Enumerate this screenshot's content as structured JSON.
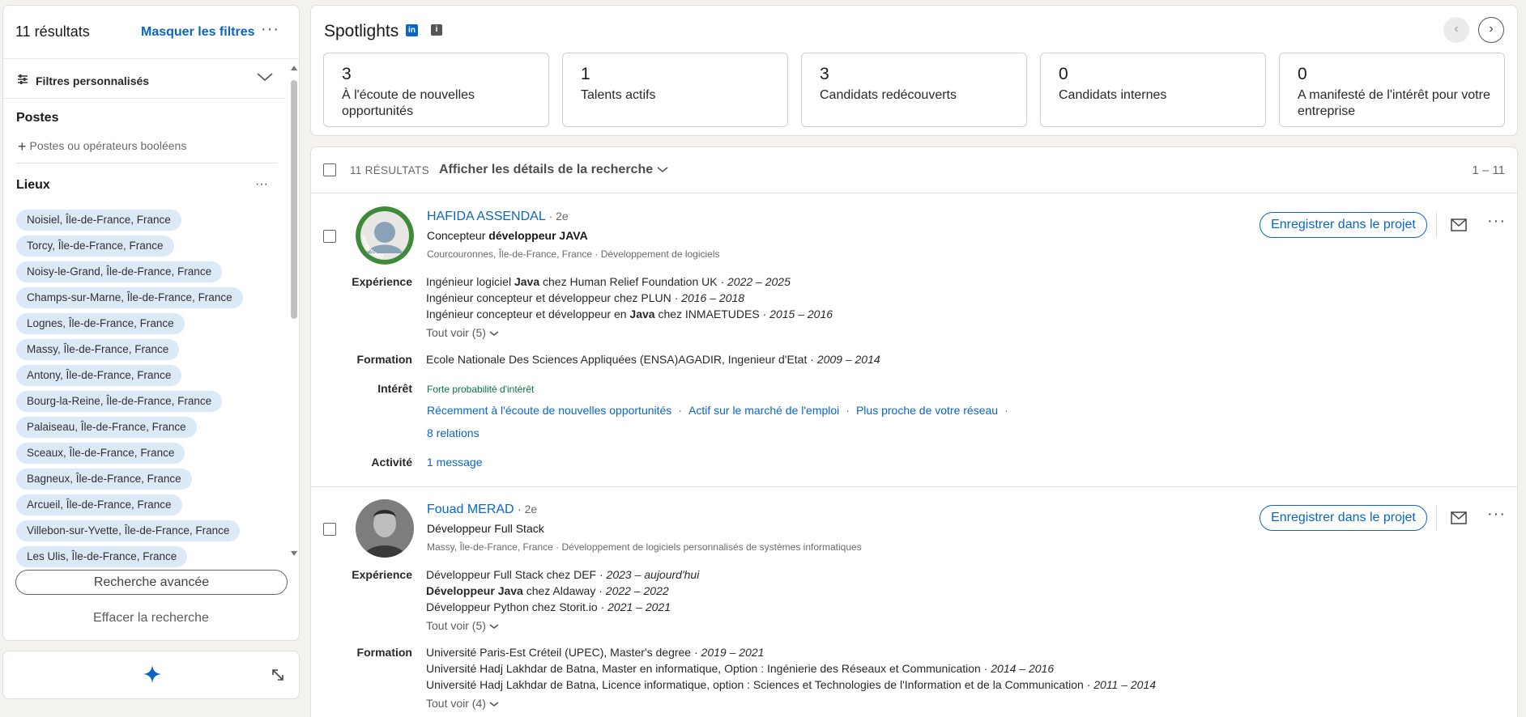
{
  "sidebar": {
    "results_count": "11 résultats",
    "hide_filters": "Masquer les filtres",
    "more": "···",
    "custom_filters": "Filtres personnalisés",
    "postes_title": "Postes",
    "postes_placeholder": "Postes ou opérateurs booléens",
    "lieux_title": "Lieux",
    "lieux_more": "···",
    "lieux": [
      "Noisiel, Île-de-France, France",
      "Torcy, Île-de-France, France",
      "Noisy-le-Grand, Île-de-France, France",
      "Champs-sur-Marne, Île-de-France, France",
      "Lognes, Île-de-France, France",
      "Massy, Île-de-France, France",
      "Antony, Île-de-France, France",
      "Bourg-la-Reine, Île-de-France, France",
      "Palaiseau, Île-de-France, France",
      "Sceaux, Île-de-France, France",
      "Bagneux, Île-de-France, France",
      "Arcueil, Île-de-France, France",
      "Villebon-sur-Yvette, Île-de-France, France",
      "Les Ulis, Île-de-France, France"
    ],
    "advanced_search": "Recherche avancée",
    "clear_search": "Effacer la recherche"
  },
  "spotlights": {
    "title": "Spotlights",
    "li_badge": "in",
    "info_badge": "i",
    "prev": "‹",
    "next": "›",
    "cards": [
      {
        "count": "3",
        "label": "À l'écoute de nouvelles opportunités"
      },
      {
        "count": "1",
        "label": "Talents actifs"
      },
      {
        "count": "3",
        "label": "Candidats redécouverts"
      },
      {
        "count": "0",
        "label": "Candidats internes"
      },
      {
        "count": "0",
        "label": "A manifesté de l'intérêt pour votre entreprise"
      }
    ]
  },
  "results": {
    "count_label": "11 RÉSULTATS",
    "show_details": "Afficher les détails de la recherche",
    "range": "1 – 11",
    "save_label": "Enregistrer dans le projet",
    "more": "···",
    "labels": {
      "experience": "Expérience",
      "formation": "Formation",
      "interet": "Intérêt",
      "activite": "Activité"
    },
    "candidates": [
      {
        "name": "HAFIDA ASSENDAL",
        "degree": "· 2e",
        "headline_pre": "Concepteur ",
        "headline_bold": "développeur JAVA",
        "location": "Courcouronnes, Île-de-France, France · Développement de logiciels",
        "avatar_text": "#OPENTOWORK",
        "experience": [
          {
            "pre": "Ingénieur logiciel ",
            "bold": "Java",
            "post": " chez Human Relief Foundation UK · ",
            "dates": "2022 – 2025"
          },
          {
            "pre": "Ingénieur concepteur et développeur chez PLUN · ",
            "bold": "",
            "post": "",
            "dates": "2016 – 2018"
          },
          {
            "pre": "Ingénieur concepteur et développeur en ",
            "bold": "Java",
            "post": " chez INMAETUDES · ",
            "dates": "2015 – 2016"
          }
        ],
        "experience_see_all": "Tout voir (5)",
        "formation": [
          {
            "text": "Ecole Nationale Des Sciences Appliquées (ENSA)AGADIR, Ingenieur d'Etat · ",
            "dates": "2009 – 2014"
          }
        ],
        "interest_tag": "Forte probabilité d'intérêt",
        "interest_links": [
          "Récemment à l'écoute de nouvelles opportunités",
          "Actif sur le marché de l'emploi",
          "Plus proche de votre réseau"
        ],
        "relations": "8 relations",
        "activity": "1 message"
      },
      {
        "name": "Fouad MERAD",
        "degree": "· 2e",
        "headline_pre": "Développeur Full Stack",
        "headline_bold": "",
        "location": "Massy, Île-de-France, France · Développement de logiciels personnalisés de systèmes informatiques",
        "experience": [
          {
            "pre": "Développeur Full Stack chez DEF · ",
            "bold": "",
            "post": "",
            "dates": "2023 – aujourd'hui"
          },
          {
            "pre": "",
            "bold": "Développeur Java",
            "post": " chez Aldaway · ",
            "dates": "2022 – 2022"
          },
          {
            "pre": "Développeur Python chez Storit.io · ",
            "bold": "",
            "post": "",
            "dates": "2021 – 2021"
          }
        ],
        "experience_see_all": "Tout voir (5)",
        "formation": [
          {
            "text": "Université Paris-Est Créteil (UPEC), Master's degree · ",
            "dates": "2019 – 2021"
          },
          {
            "text": "Université Hadj Lakhdar de Batna, Master en informatique, Option : Ingénierie des Réseaux et Communication · ",
            "dates": "2014 – 2016"
          },
          {
            "text": "Université Hadj Lakhdar de Batna, Licence informatique, option : Sciences et Technologies de l'Information et de la Communication · ",
            "dates": "2011 – 2014"
          }
        ],
        "formation_see_all": "Tout voir (4)"
      }
    ]
  },
  "colors": {
    "accent": "#0a66c2",
    "pill_bg": "#dce9f7",
    "interest_green": "#057642",
    "page_bg": "#f4f2ee"
  },
  "icons": [
    "sliders-icon",
    "chevron-down-icon",
    "sparkle-icon",
    "expand-icon",
    "mail-icon",
    "more-icon",
    "linkedin-icon",
    "info-icon"
  ]
}
